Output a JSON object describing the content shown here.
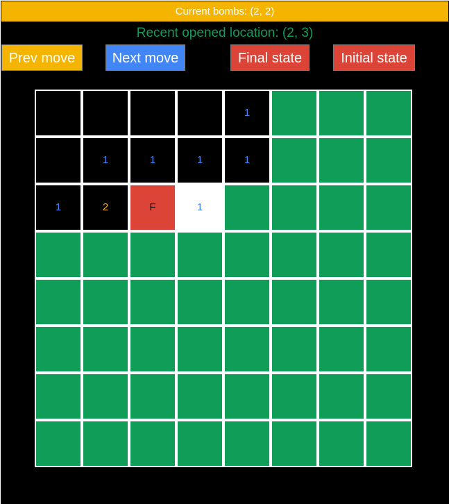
{
  "status": {
    "current_bombs": "Current bombs: (2, 2)",
    "recent_opened": "Recent opened location: (2, 3)"
  },
  "buttons": {
    "prev": "Prev move",
    "next": "Next move",
    "final": "Final state",
    "initial": "Initial state"
  },
  "colors": {
    "unopened": "#0f9d58",
    "opened": "#000000",
    "recent": "#ffffff",
    "flag": "#db4437",
    "number_1": "#4285f4",
    "number_2": "#f4b400",
    "banner": "#f4b400"
  },
  "board": {
    "rows": 8,
    "cols": 8,
    "cells": [
      [
        "E",
        "E",
        "E",
        "E",
        "1",
        "U",
        "U",
        "U"
      ],
      [
        "E",
        "1",
        "1",
        "1",
        "1",
        "U",
        "U",
        "U"
      ],
      [
        "1",
        "2",
        "F",
        "R1",
        "U",
        "U",
        "U",
        "U"
      ],
      [
        "U",
        "U",
        "U",
        "U",
        "U",
        "U",
        "U",
        "U"
      ],
      [
        "U",
        "U",
        "U",
        "U",
        "U",
        "U",
        "U",
        "U"
      ],
      [
        "U",
        "U",
        "U",
        "U",
        "U",
        "U",
        "U",
        "U"
      ],
      [
        "U",
        "U",
        "U",
        "U",
        "U",
        "U",
        "U",
        "U"
      ],
      [
        "U",
        "U",
        "U",
        "U",
        "U",
        "U",
        "U",
        "U"
      ]
    ]
  }
}
